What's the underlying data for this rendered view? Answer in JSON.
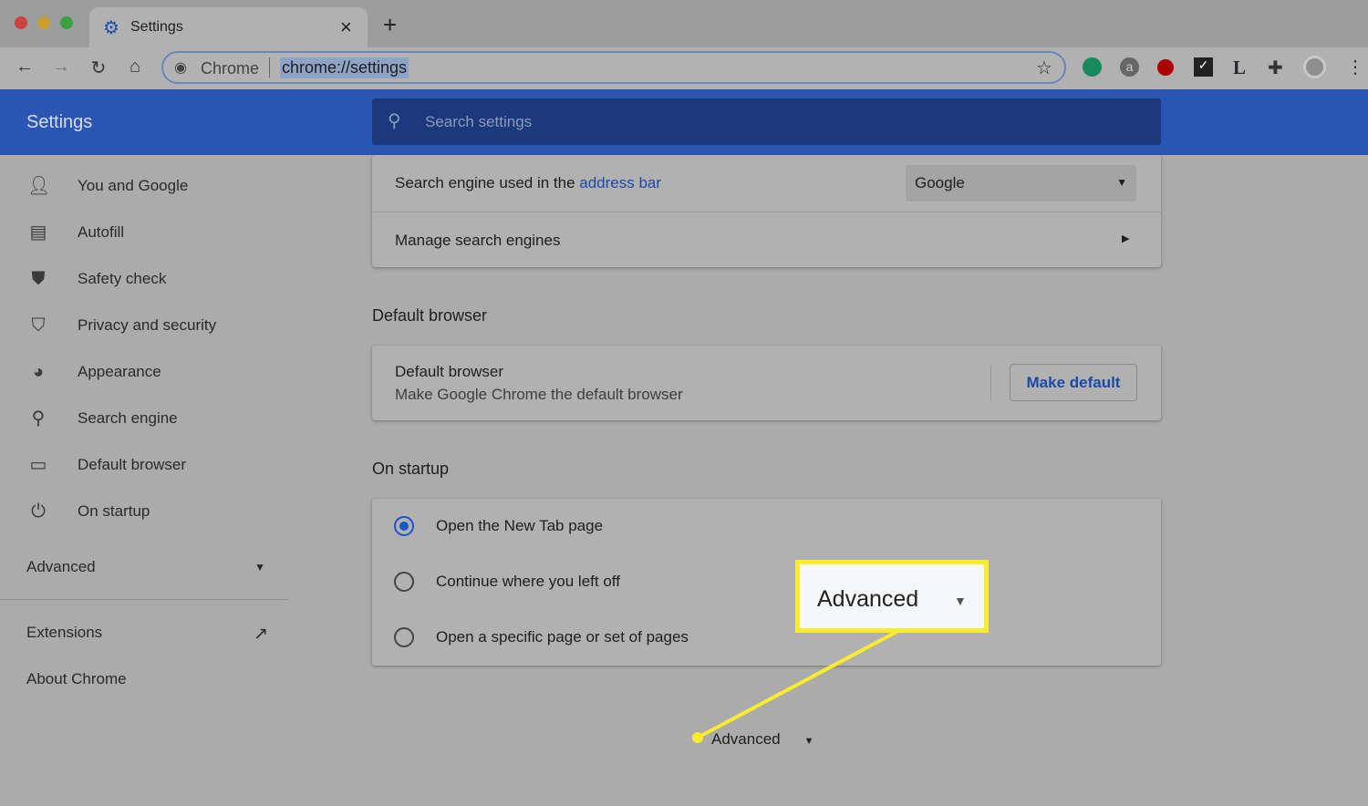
{
  "window": {
    "tab_title": "Settings",
    "new_tab": "+",
    "close_tab": "×"
  },
  "omnibox": {
    "site_label": "Chrome",
    "url": "chrome://settings"
  },
  "extensions": [
    "grammarly",
    "a",
    "opera-red",
    "checkmark",
    "L",
    "puzzle",
    "profile"
  ],
  "header": {
    "title": "Settings",
    "search_placeholder": "Search settings"
  },
  "sidebar": {
    "items": [
      {
        "label": "You and Google",
        "icon": "person-icon"
      },
      {
        "label": "Autofill",
        "icon": "clipboard-icon"
      },
      {
        "label": "Safety check",
        "icon": "shield-check-icon"
      },
      {
        "label": "Privacy and security",
        "icon": "shield-icon"
      },
      {
        "label": "Appearance",
        "icon": "palette-icon"
      },
      {
        "label": "Search engine",
        "icon": "search-icon"
      },
      {
        "label": "Default browser",
        "icon": "browser-icon"
      },
      {
        "label": "On startup",
        "icon": "power-icon"
      }
    ],
    "advanced": "Advanced",
    "extensions": "Extensions",
    "about": "About Chrome"
  },
  "search_engine": {
    "label_prefix": "Search engine used in the ",
    "label_link": "address bar",
    "selected": "Google",
    "manage": "Manage search engines"
  },
  "default_browser": {
    "section": "Default browser",
    "title": "Default browser",
    "subtitle": "Make Google Chrome the default browser",
    "button": "Make default"
  },
  "on_startup": {
    "section": "On startup",
    "options": [
      "Open the New Tab page",
      "Continue where you left off",
      "Open a specific page or set of pages"
    ],
    "selected": 0
  },
  "advanced_footer": "Advanced",
  "callout": {
    "label": "Advanced",
    "color": "#f8ec2d"
  },
  "colors": {
    "header": "#2b55b3",
    "link": "#1a4aa8",
    "accent": "#1a56c8"
  }
}
